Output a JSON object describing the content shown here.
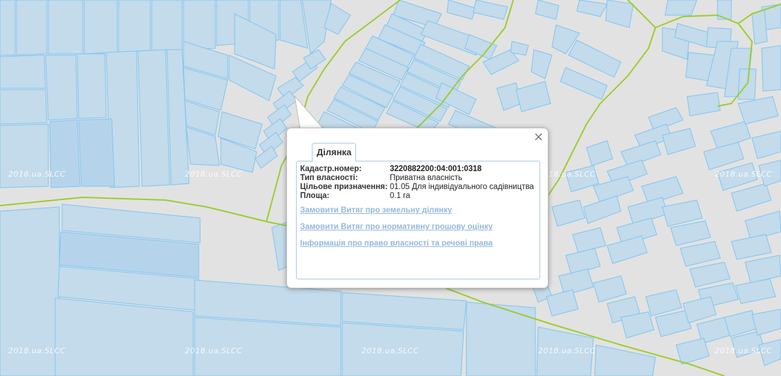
{
  "popup": {
    "tab_title": "Ділянка",
    "close_symbol": "×",
    "fields": [
      {
        "label": "Кадастр.номер:",
        "value": "3220882200:04:001:0318"
      },
      {
        "label": "Тип власності:",
        "value": "Приватна власність"
      },
      {
        "label": "Цільове призначення:",
        "value": "01.05 Для індивідуального садівництва"
      },
      {
        "label": "Площа:",
        "value": "0.1 га"
      }
    ],
    "links": [
      "Замовити Витяг про земельну ділянку",
      "Замовити Витяг про нормативну грошову оцінку",
      "Інформація про право власності та речові права"
    ]
  },
  "watermark": "2018.ua.SLCC",
  "colors": {
    "background": "#e2e2e2",
    "parcel_fill": "#c3dbeb",
    "parcel_stroke": "#7fc4f2",
    "boundary": "#9ccc2f",
    "link": "#94b9dd"
  },
  "icons": {
    "close": "close-icon"
  }
}
